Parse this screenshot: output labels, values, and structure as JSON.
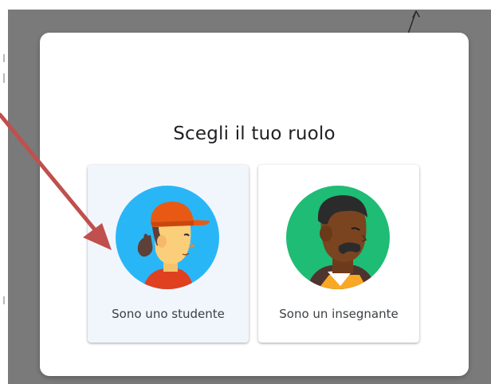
{
  "dialog": {
    "title": "Scegli il tuo ruolo"
  },
  "roles": [
    {
      "id": "student",
      "label": "Sono uno studente",
      "selected": true,
      "avatar_icon": "student-avatar-icon"
    },
    {
      "id": "teacher",
      "label": "Sono un insegnante",
      "selected": false,
      "avatar_icon": "teacher-avatar-icon"
    }
  ],
  "colors": {
    "backdrop": "#7a7a7a",
    "dialog_bg": "#ffffff",
    "student_card_bg": "#f1f6fd",
    "student_avatar_bg": "#29b6f6",
    "teacher_avatar_bg": "#1ebc74",
    "annotation_arrow": "#c0504d"
  }
}
